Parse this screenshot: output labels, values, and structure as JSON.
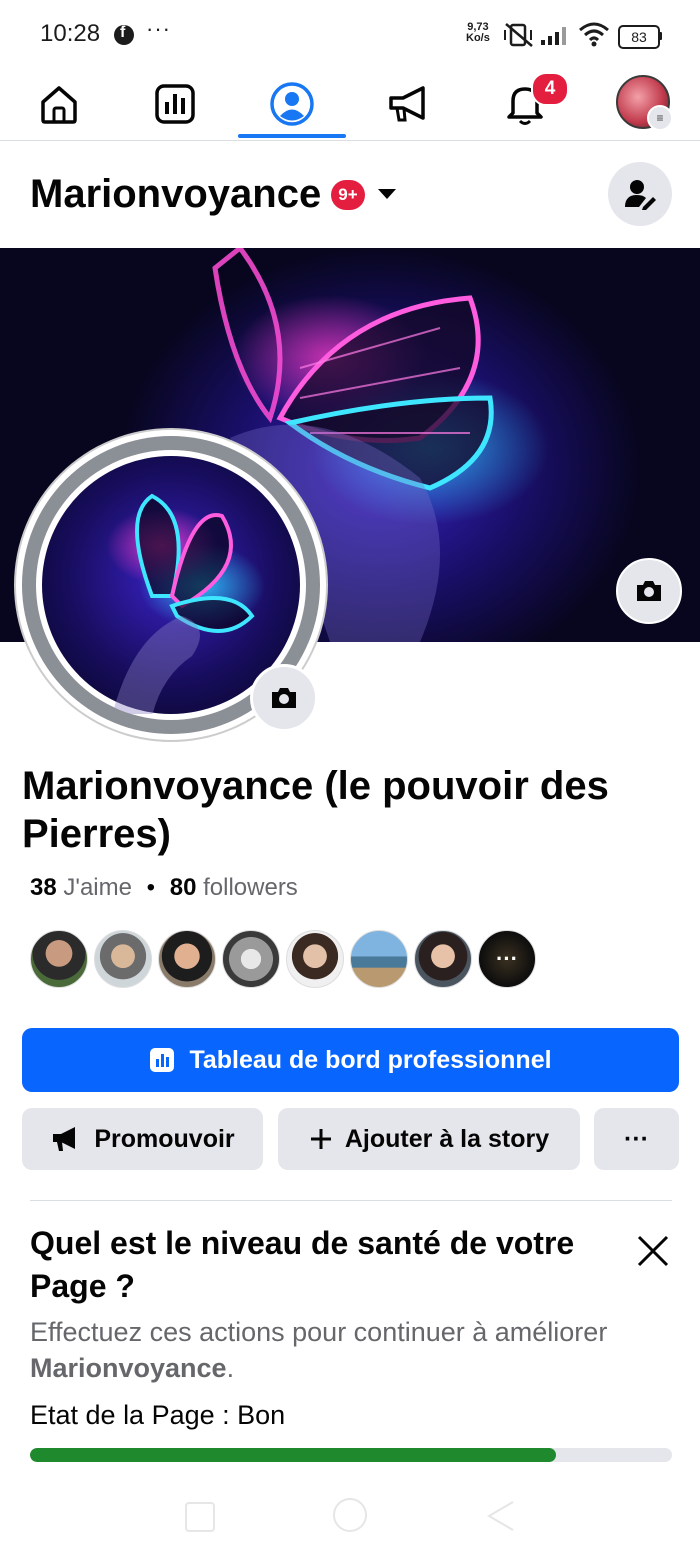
{
  "status_bar": {
    "time": "10:28",
    "more": "···",
    "speed_value": "9,73",
    "speed_unit": "Ko/s",
    "battery": "83"
  },
  "top_nav": {
    "items": [
      "home-icon",
      "dashboard-icon",
      "profile-icon",
      "megaphone-icon",
      "bell-icon",
      "account-avatar"
    ],
    "active_index": 2,
    "notification_count": "4"
  },
  "header": {
    "title": "Marionvoyance",
    "badge": "9+"
  },
  "profile": {
    "name": "Marionvoyance (le pouvoir des Pierres)",
    "likes_count": "38",
    "likes_label": "J'aime",
    "separator": "•",
    "followers_count": "80",
    "followers_label": "followers",
    "more_followers": "···"
  },
  "actions": {
    "dashboard_label": "Tableau de bord professionnel",
    "promote_label": "Promouvoir",
    "add_story_label": "Ajouter à la story",
    "more_label": "···"
  },
  "health_card": {
    "title": "Quel est le niveau de santé de votre Page ?",
    "desc_prefix": "Effectuez ces actions pour continuer à améliorer ",
    "desc_page": "Marionvoyance",
    "desc_suffix": ".",
    "state_label": "Etat de la Page :",
    "state_value": "Bon",
    "progress": 0.82
  },
  "colors": {
    "accent": "#0866ff",
    "badge_red": "#e41e3f",
    "progress_green": "#1f8a2d"
  }
}
